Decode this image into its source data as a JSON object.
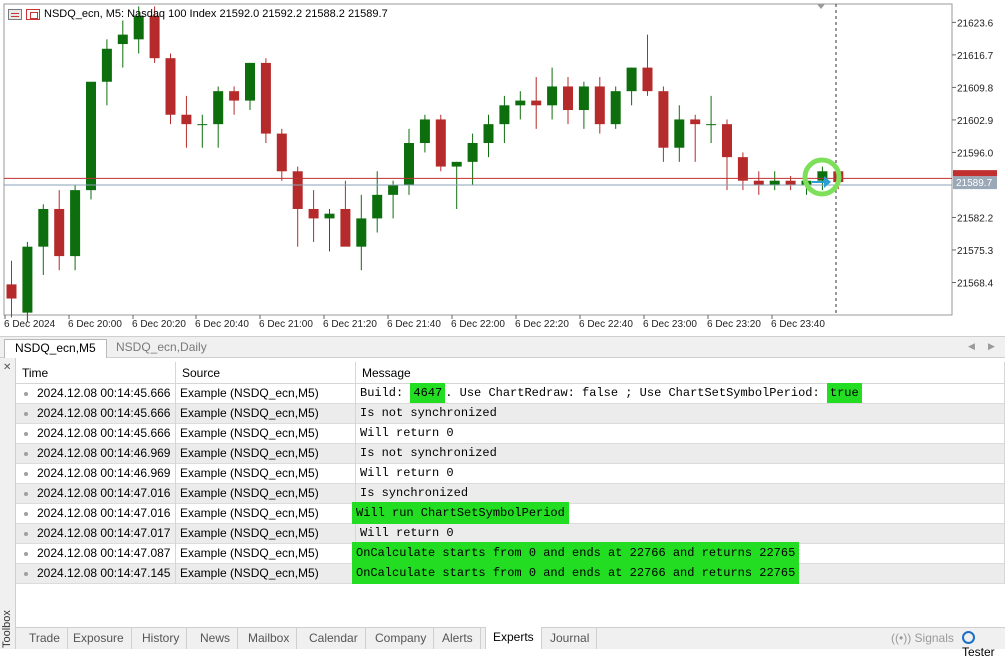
{
  "chart": {
    "header_text": "NSDQ_ecn, M5:  Nasdaq 100 Index  21592.0 21592.2 21588.2 21589.7",
    "price_labels": [
      "21623.6",
      "21616.7",
      "21609.8",
      "21602.9",
      "21596.0",
      "21582.2",
      "21575.3",
      "21568.4"
    ],
    "current_price": "21589.7",
    "time_labels": [
      "6 Dec 2024",
      "6 Dec 20:00",
      "6 Dec 20:20",
      "6 Dec 20:40",
      "6 Dec 21:00",
      "6 Dec 21:20",
      "6 Dec 21:40",
      "6 Dec 22:00",
      "6 Dec 22:20",
      "6 Dec 22:40",
      "6 Dec 23:00",
      "6 Dec 23:20",
      "6 Dec 23:40"
    ],
    "colors": {
      "bull": "#0d6e0d",
      "bear": "#b52b2b",
      "bid_line": "#c03030",
      "ask_line": "#8aa0b8",
      "highlight": "#7ee05a"
    },
    "candles": [
      {
        "o": 21568.0,
        "h": 21573.0,
        "l": 21561.0,
        "c": 21565.0
      },
      {
        "o": 21562.0,
        "h": 21577.0,
        "l": 21560.0,
        "c": 21576.0
      },
      {
        "o": 21576.0,
        "h": 21585.0,
        "l": 21570.0,
        "c": 21584.0
      },
      {
        "o": 21584.0,
        "h": 21588.0,
        "l": 21571.0,
        "c": 21574.0
      },
      {
        "o": 21574.0,
        "h": 21589.0,
        "l": 21571.0,
        "c": 21588.0
      },
      {
        "o": 21588.0,
        "h": 21610.0,
        "l": 21586.0,
        "c": 21611.0
      },
      {
        "o": 21611.0,
        "h": 21620.0,
        "l": 21606.0,
        "c": 21618.0
      },
      {
        "o": 21619.0,
        "h": 21624.0,
        "l": 21614.0,
        "c": 21621.0
      },
      {
        "o": 21620.0,
        "h": 21627.0,
        "l": 21617.0,
        "c": 21625.0
      },
      {
        "o": 21625.0,
        "h": 21627.0,
        "l": 21615.0,
        "c": 21616.0
      },
      {
        "o": 21616.0,
        "h": 21617.0,
        "l": 21602.0,
        "c": 21604.0
      },
      {
        "o": 21604.0,
        "h": 21608.0,
        "l": 21597.0,
        "c": 21602.0
      },
      {
        "o": 21602.0,
        "h": 21604.0,
        "l": 21597.0,
        "c": 21602.0
      },
      {
        "o": 21602.0,
        "h": 21610.0,
        "l": 21597.0,
        "c": 21609.0
      },
      {
        "o": 21609.0,
        "h": 21610.0,
        "l": 21604.0,
        "c": 21607.0
      },
      {
        "o": 21607.0,
        "h": 21615.0,
        "l": 21605.0,
        "c": 21615.0
      },
      {
        "o": 21615.0,
        "h": 21616.0,
        "l": 21598.0,
        "c": 21600.0
      },
      {
        "o": 21600.0,
        "h": 21601.0,
        "l": 21590.0,
        "c": 21592.0
      },
      {
        "o": 21592.0,
        "h": 21593.0,
        "l": 21576.0,
        "c": 21584.0
      },
      {
        "o": 21584.0,
        "h": 21588.0,
        "l": 21577.0,
        "c": 21582.0
      },
      {
        "o": 21582.0,
        "h": 21584.0,
        "l": 21575.0,
        "c": 21583.0
      },
      {
        "o": 21584.0,
        "h": 21590.0,
        "l": 21579.0,
        "c": 21576.0
      },
      {
        "o": 21576.0,
        "h": 21587.0,
        "l": 21571.0,
        "c": 21582.0
      },
      {
        "o": 21582.0,
        "h": 21592.0,
        "l": 21579.0,
        "c": 21587.0
      },
      {
        "o": 21587.0,
        "h": 21590.0,
        "l": 21582.0,
        "c": 21589.0
      },
      {
        "o": 21589.0,
        "h": 21601.0,
        "l": 21587.0,
        "c": 21598.0
      },
      {
        "o": 21598.0,
        "h": 21604.0,
        "l": 21596.0,
        "c": 21603.0
      },
      {
        "o": 21603.0,
        "h": 21604.0,
        "l": 21592.0,
        "c": 21593.0
      },
      {
        "o": 21593.0,
        "h": 21594.0,
        "l": 21584.0,
        "c": 21594.0
      },
      {
        "o": 21594.0,
        "h": 21600.0,
        "l": 21589.0,
        "c": 21598.0
      },
      {
        "o": 21598.0,
        "h": 21604.0,
        "l": 21595.0,
        "c": 21602.0
      },
      {
        "o": 21602.0,
        "h": 21608.0,
        "l": 21598.0,
        "c": 21606.0
      },
      {
        "o": 21606.0,
        "h": 21609.0,
        "l": 21603.0,
        "c": 21607.0
      },
      {
        "o": 21607.0,
        "h": 21612.0,
        "l": 21601.0,
        "c": 21606.0
      },
      {
        "o": 21606.0,
        "h": 21614.0,
        "l": 21603.0,
        "c": 21610.0
      },
      {
        "o": 21610.0,
        "h": 21612.0,
        "l": 21602.0,
        "c": 21605.0
      },
      {
        "o": 21605.0,
        "h": 21611.0,
        "l": 21601.0,
        "c": 21610.0
      },
      {
        "o": 21610.0,
        "h": 21612.0,
        "l": 21600.0,
        "c": 21602.0
      },
      {
        "o": 21602.0,
        "h": 21610.0,
        "l": 21601.0,
        "c": 21609.0
      },
      {
        "o": 21609.0,
        "h": 21614.0,
        "l": 21606.0,
        "c": 21614.0
      },
      {
        "o": 21614.0,
        "h": 21621.0,
        "l": 21608.0,
        "c": 21609.0
      },
      {
        "o": 21609.0,
        "h": 21610.0,
        "l": 21594.0,
        "c": 21597.0
      },
      {
        "o": 21597.0,
        "h": 21606.0,
        "l": 21594.0,
        "c": 21603.0
      },
      {
        "o": 21603.0,
        "h": 21604.0,
        "l": 21594.0,
        "c": 21602.0
      },
      {
        "o": 21602.0,
        "h": 21608.0,
        "l": 21598.0,
        "c": 21602.0
      },
      {
        "o": 21602.0,
        "h": 21603.0,
        "l": 21588.0,
        "c": 21595.0
      },
      {
        "o": 21595.0,
        "h": 21596.0,
        "l": 21588.0,
        "c": 21590.0
      },
      {
        "o": 21590.0,
        "h": 21592.0,
        "l": 21587.0,
        "c": 21589.0
      },
      {
        "o": 21589.0,
        "h": 21592.0,
        "l": 21588.0,
        "c": 21590.0
      },
      {
        "o": 21590.0,
        "h": 21591.0,
        "l": 21588.0,
        "c": 21589.0
      },
      {
        "o": 21589.0,
        "h": 21591.0,
        "l": 21587.0,
        "c": 21590.0
      },
      {
        "o": 21590.0,
        "h": 21593.0,
        "l": 21588.0,
        "c": 21592.0
      },
      {
        "o": 21592.0,
        "h": 21592.2,
        "l": 21588.2,
        "c": 21589.7
      }
    ]
  },
  "chart_tabs": [
    "NSDQ_ecn,M5",
    "NSDQ_ecn,Daily"
  ],
  "log": {
    "columns": [
      "Time",
      "Source",
      "Message"
    ],
    "rows": [
      {
        "time": "2024.12.08 00:14:45.666",
        "source": "Example (NSDQ_ecn,M5)",
        "msg": "Build: 4647. Use ChartRedraw: false ; Use ChartSetSymbolPeriod: true",
        "hl": "partial"
      },
      {
        "time": "2024.12.08 00:14:45.666",
        "source": "Example (NSDQ_ecn,M5)",
        "msg": "Is not synchronized"
      },
      {
        "time": "2024.12.08 00:14:45.666",
        "source": "Example (NSDQ_ecn,M5)",
        "msg": "Will return 0"
      },
      {
        "time": "2024.12.08 00:14:46.969",
        "source": "Example (NSDQ_ecn,M5)",
        "msg": "Is not synchronized"
      },
      {
        "time": "2024.12.08 00:14:46.969",
        "source": "Example (NSDQ_ecn,M5)",
        "msg": "Will return 0"
      },
      {
        "time": "2024.12.08 00:14:47.016",
        "source": "Example (NSDQ_ecn,M5)",
        "msg": "Is synchronized"
      },
      {
        "time": "2024.12.08 00:14:47.016",
        "source": "Example (NSDQ_ecn,M5)",
        "msg": "Will run ChartSetSymbolPeriod",
        "hl": "full"
      },
      {
        "time": "2024.12.08 00:14:47.017",
        "source": "Example (NSDQ_ecn,M5)",
        "msg": "Will return 0"
      },
      {
        "time": "2024.12.08 00:14:47.087",
        "source": "Example (NSDQ_ecn,M5)",
        "msg": "OnCalculate starts from 0 and ends at 22766 and returns 22765",
        "hl": "full"
      },
      {
        "time": "2024.12.08 00:14:47.145",
        "source": "Example (NSDQ_ecn,M5)",
        "msg": "OnCalculate starts from 0 and ends at 22766 and returns 22765",
        "hl": "full"
      }
    ],
    "first_row_parts": {
      "a": "Build: ",
      "b": "4647",
      "c": ". Use ChartRedraw: false ; Use ChartSetSymbolPeriod: ",
      "d": "true"
    }
  },
  "toolbox": {
    "label": "Toolbox",
    "tabs": [
      "Trade",
      "Exposure",
      "History",
      "News",
      "Mailbox",
      "Calendar",
      "Company",
      "Alerts",
      "Experts",
      "Journal"
    ],
    "active_tab": "Experts",
    "signals_label": "Signals",
    "tester_label": "Tester"
  }
}
